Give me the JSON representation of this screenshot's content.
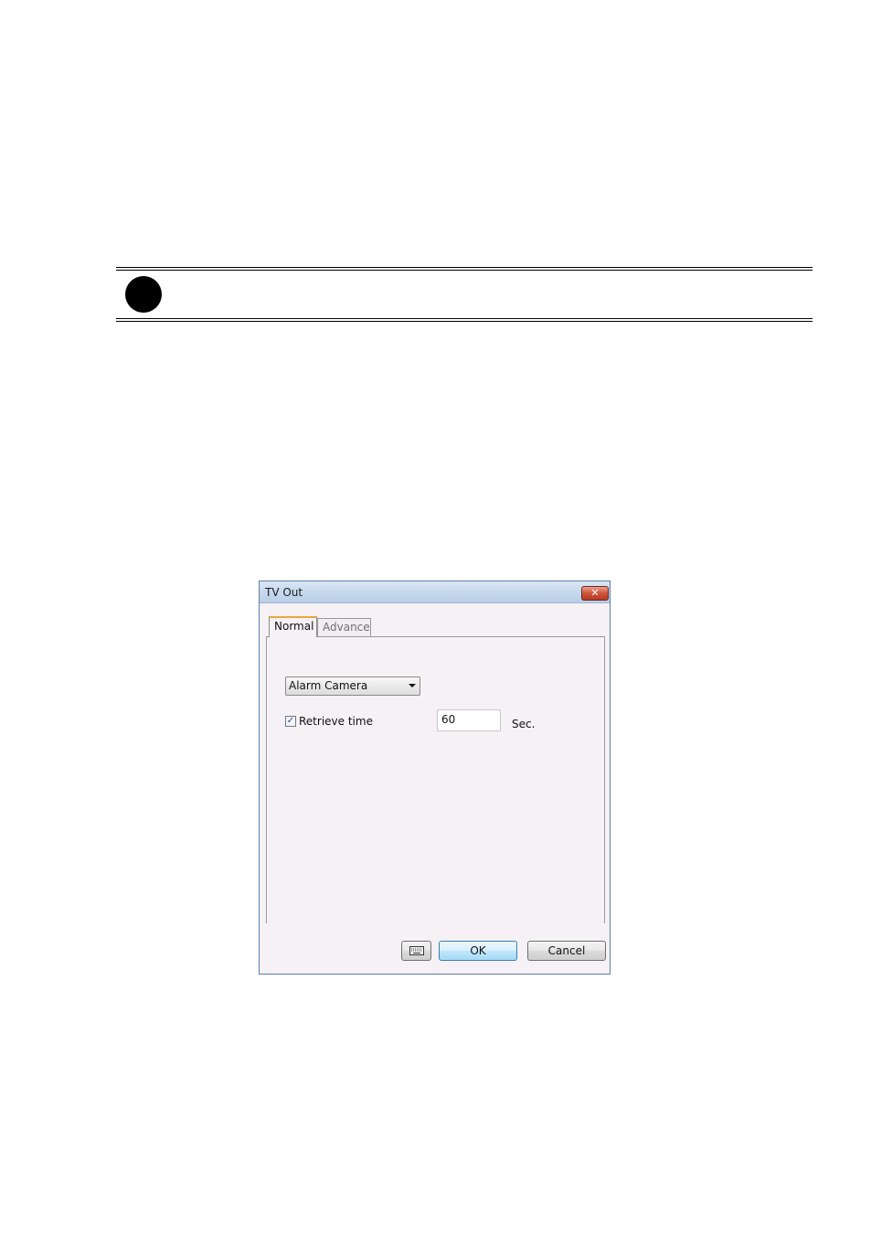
{
  "dialog": {
    "title": "TV Out",
    "close_label": "✕",
    "tabs": [
      {
        "label": "Normal",
        "active": true
      },
      {
        "label": "Advance",
        "active": false
      }
    ],
    "camera_select": {
      "value": "Alarm Camera"
    },
    "retrieve": {
      "checked": true,
      "check_glyph": "✓",
      "label": "Retrieve time",
      "value": "60",
      "unit": "Sec."
    },
    "buttons": {
      "keyboard_icon": "keyboard-icon",
      "ok": "OK",
      "cancel": "Cancel"
    }
  }
}
